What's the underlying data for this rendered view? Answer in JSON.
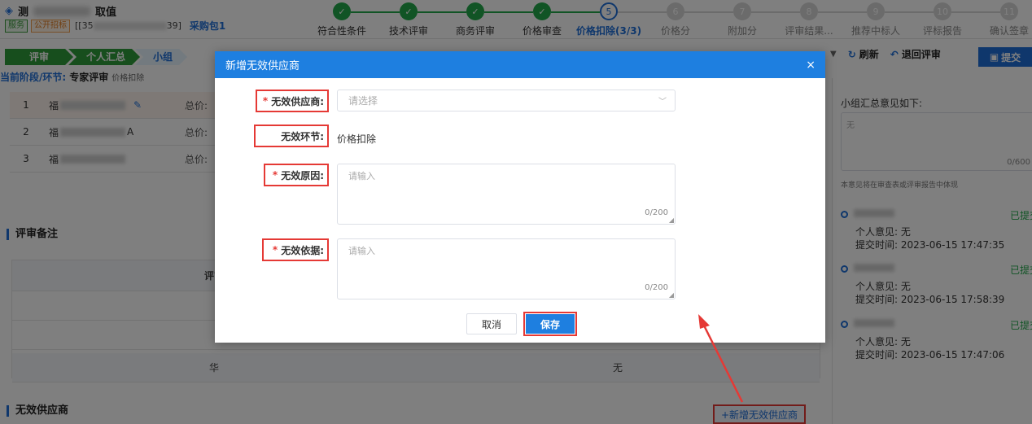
{
  "header": {
    "title_prefix": "测",
    "title_suffix": "取值",
    "tag_service": "服务",
    "tag_open_tender": "公开招标",
    "code_prefix": "[[35",
    "code_suffix": "39]",
    "package": "采购包1"
  },
  "steps": [
    {
      "num": "✓",
      "label": "符合性条件",
      "state": "done"
    },
    {
      "num": "✓",
      "label": "技术评审",
      "state": "done"
    },
    {
      "num": "✓",
      "label": "商务评审",
      "state": "done"
    },
    {
      "num": "✓",
      "label": "价格审查",
      "state": "done"
    },
    {
      "num": "5",
      "label": "价格扣除(3/3)",
      "state": "current"
    },
    {
      "num": "6",
      "label": "价格分",
      "state": "todo"
    },
    {
      "num": "7",
      "label": "附加分",
      "state": "todo"
    },
    {
      "num": "8",
      "label": "评审结果...",
      "state": "todo"
    },
    {
      "num": "9",
      "label": "推荐中标人",
      "state": "todo"
    },
    {
      "num": "10",
      "label": "评标报告",
      "state": "todo"
    },
    {
      "num": "11",
      "label": "确认签章",
      "state": "todo"
    }
  ],
  "breadcrumb": {
    "review": "评审",
    "personal_summary": "个人汇总",
    "group": "小组"
  },
  "stage": {
    "label": "当前阶段/环节:",
    "value": "专家评审",
    "sub": "价格扣除"
  },
  "suppliers": [
    {
      "index": "1",
      "name_prefix": "福",
      "name_suffix": "",
      "price_label": "总价:"
    },
    {
      "index": "2",
      "name_prefix": "福",
      "name_suffix": "A",
      "price_label": "总价:"
    },
    {
      "index": "3",
      "name_prefix": "福",
      "name_suffix": "",
      "price_label": "总价:"
    }
  ],
  "remarks": {
    "title": "评审备注",
    "header_left": "评审",
    "last_row_left": "华",
    "last_row_right": "无"
  },
  "invalid_section": {
    "title": "无效供应商",
    "add_button": "+新增无效供应商"
  },
  "right_toolbar": {
    "refresh": "刷新",
    "return_review": "退回评审",
    "submit": "提交"
  },
  "right_panel": {
    "heading": "小组汇总意见如下:",
    "textarea_value": "无",
    "count": "0/600",
    "note": "本意见将在审查表或评审报告中体现",
    "timeline": [
      {
        "status": "已提交",
        "opinion": "个人意见:  无",
        "time": "提交时间:  2023-06-15 17:47:35"
      },
      {
        "status": "已提交",
        "opinion": "个人意见:  无",
        "time": "提交时间:  2023-06-15 17:58:39"
      },
      {
        "status": "已提交",
        "opinion": "个人意见:  无",
        "time": "提交时间:  2023-06-15 17:47:06"
      }
    ]
  },
  "dialog": {
    "title": "新增无效供应商",
    "close": "×",
    "supplier_label": "无效供应商:",
    "supplier_placeholder": "请选择",
    "stage_label": "无效环节:",
    "stage_value": "价格扣除",
    "reason_label": "无效原因:",
    "reason_placeholder": "请输入",
    "reason_count": "0/200",
    "basis_label": "无效依据:",
    "basis_placeholder": "请输入",
    "basis_count": "0/200",
    "cancel": "取消",
    "save": "保存"
  },
  "colors": {
    "primary": "#1e7fe0",
    "success": "#23a84b",
    "danger": "#e53935"
  }
}
